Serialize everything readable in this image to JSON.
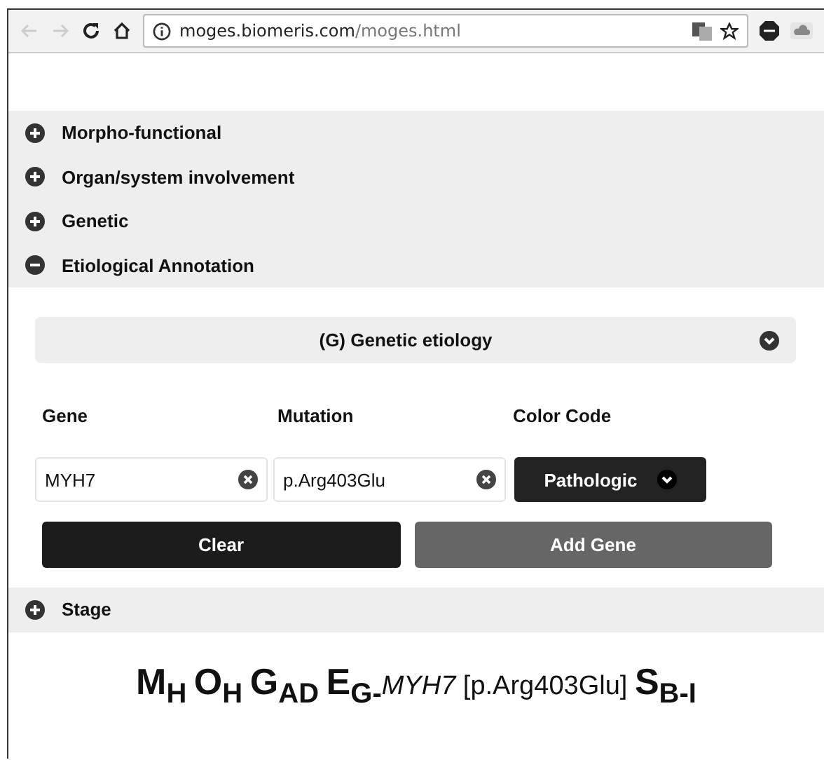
{
  "browser": {
    "back_disabled": true,
    "forward_disabled": true,
    "url_host": "moges.biomeris.com",
    "url_path": "/moges.html"
  },
  "sections": [
    {
      "label": "Morpho-functional",
      "expanded": false
    },
    {
      "label": "Organ/system involvement",
      "expanded": false
    },
    {
      "label": "Genetic",
      "expanded": false
    },
    {
      "label": "Etiological Annotation",
      "expanded": true
    }
  ],
  "etiology": {
    "header": "(G) Genetic etiology",
    "labels": [
      "Gene",
      "Mutation",
      "Color Code"
    ],
    "gene": "MYH7",
    "mutation": "p.Arg403Glu",
    "color_code": "Pathologic",
    "buttons": [
      {
        "label": "Clear",
        "kind": "dark"
      },
      {
        "label": "Add Gene",
        "kind": "grey"
      }
    ]
  },
  "stage": {
    "label": "Stage",
    "expanded": false
  },
  "formula": "**M**$_{H}$ **O**$_{H}$ **G**$_{AD}$ **E**$_{G-}$*MYH7* [p.Arg403Glu] **S**$_{B-I}$"
}
